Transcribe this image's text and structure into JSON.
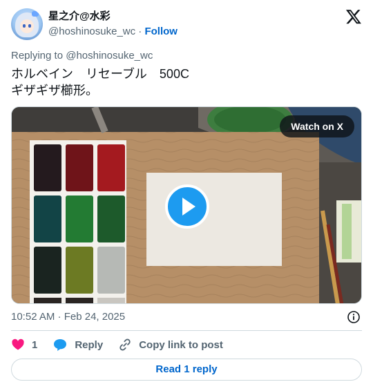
{
  "author": {
    "display_name": "星之介@水彩",
    "handle": "@hoshinosuke_wc",
    "separator": " · ",
    "follow_label": "Follow"
  },
  "reply_to": "Replying to @hoshinosuke_wc",
  "tweet": {
    "line1": "ホルベイン　リセーブル　500C",
    "line2": "ギザギザ櫛形。"
  },
  "media": {
    "watch_label": "Watch on X"
  },
  "meta": {
    "timestamp": "10:52 AM · Feb 24, 2025"
  },
  "actions": {
    "like_count": "1",
    "reply_label": "Reply",
    "copy_label": "Copy link to post"
  },
  "read_reply_label": "Read 1 reply",
  "icons": [
    "x-logo-icon",
    "heart-icon",
    "reply-bubble-icon",
    "link-icon",
    "info-icon",
    "play-icon"
  ],
  "colors": {
    "accent": "#1d9bf0",
    "link": "#0066cc",
    "like": "#f91880",
    "muted": "#536471"
  }
}
